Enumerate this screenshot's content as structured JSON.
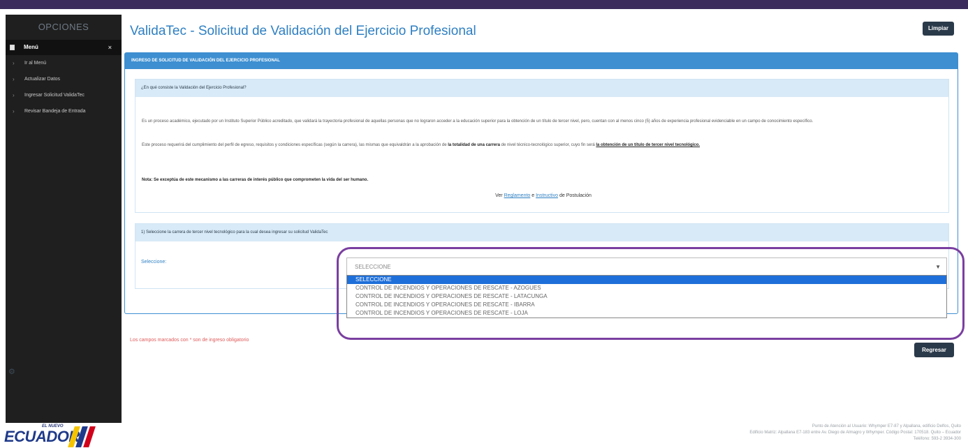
{
  "sidebar": {
    "title": "OPCIONES",
    "menu_label": "Menú",
    "collapse_symbol": "×",
    "items": [
      {
        "label": "Ir al Menú"
      },
      {
        "label": "Actualizar Datos"
      },
      {
        "label": "Ingresar Solicitud ValidaTec"
      },
      {
        "label": "Revisar Bandeja de Entrada"
      }
    ]
  },
  "logo": {
    "small_text": "EL NUEVO",
    "word": "ECUADOR",
    "colors": [
      "#f5c400",
      "#1f3a8a",
      "#d0021b"
    ]
  },
  "header": {
    "title": "ValidaTec - Solicitud de Validación del Ejercicio Profesional",
    "clear_label": "Limpiar"
  },
  "panel": {
    "heading": "INGRESO DE SOLICITUD DE VALIDACIÓN DEL EJERCICIO PROFESIONAL",
    "info": {
      "heading": "¿En qué consiste la Validación del Ejercicio Profesional?",
      "paragraph1": "Es un proceso académico, ejecutado por un Instituto Superior Público acreditado, que validará la trayectoria profesional de aquellas personas que no lograron acceder a la educación superior para la obtención de un título de tercer nivel, pero, cuentan con al menos cinco (5) años de experiencia profesional evidenciable en un campo de conocimiento específico.",
      "paragraph2_start": "Este proceso requerirá del cumplimiento del perfil de egreso, requisitos y condiciones específicas (según la carrera), las mismas que equivaldrán a la aprobación de ",
      "paragraph2_bold": "la totalidad de una carrera",
      "paragraph2_mid": " de nivel técnico-tecnológico superior, cuyo fin será ",
      "paragraph2_link": "la obtención de un título de tercer nivel tecnológico.",
      "note": "Nota: Se exceptúa de este mecanismo a las carreras de interés público que comprometen la vida del ser humano.",
      "see_prefix": "Ver ",
      "link_reglamento": "Reglamento",
      "see_and": " e ",
      "link_instructivo": "Instructivo",
      "see_suffix": " de Postulación"
    },
    "select_section": {
      "heading": "1)  Seleccione la carrera de tercer nivel tecnológico para la cual desea ingresar su solicitud ValidaTec",
      "label": "Seleccione:",
      "current_value": "SELECCIONE",
      "options": [
        "SELECCIONE",
        "CONTROL DE INCENDIOS Y OPERACIONES DE RESCATE - AZOGUES",
        "CONTROL DE INCENDIOS Y OPERACIONES DE RESCATE - LATACUNGA",
        "CONTROL DE INCENDIOS Y OPERACIONES DE RESCATE - IBARRA",
        "CONTROL DE INCENDIOS Y OPERACIONES DE RESCATE - LOJA"
      ],
      "selected_index": 0
    }
  },
  "footnote": "Los campos marcados con * son de ingreso obligatorio",
  "back_label": "Regresar",
  "footer": {
    "line1": "Punto de Atención al Usuario: Whymper E7-87 y Alpallana, edificio Delfos, Quito",
    "line2": "Edificio Matriz: Alpallana E7-183 entre Av. Diego de Almagro y Whymper. Código Postal: 170518. Quito – Ecuador",
    "line3": "Teléfono: 593-2 3934-300"
  }
}
